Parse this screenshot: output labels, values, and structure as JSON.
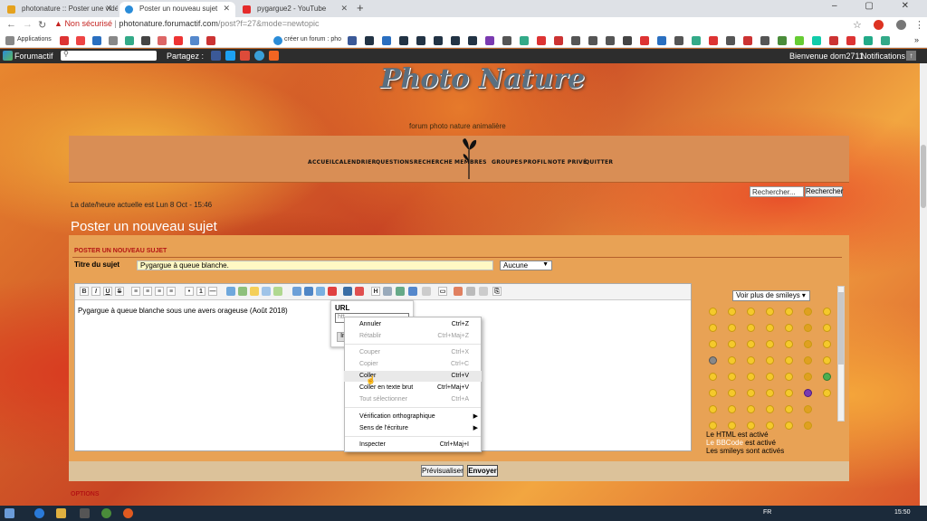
{
  "browser": {
    "tabs": [
      {
        "title": "photonature :: Poster une vidéo",
        "active": false,
        "favicon_color": "#e5a21e"
      },
      {
        "title": "Poster un nouveau sujet",
        "active": true,
        "favicon_color": "#2a8cd8"
      },
      {
        "title": "pygargue2 - YouTube",
        "active": false,
        "favicon_color": "#e52b2b"
      }
    ],
    "new_tab_label": "+",
    "window_controls": "– ▢ ✕",
    "security_label": "Non sécurisé",
    "url_host": "photonature.forumactif.com",
    "url_path": "/post?f=27&mode=newtopic",
    "star_icon": "☆",
    "menu_icon": "⋮",
    "bookmarks": {
      "apps_label": "Applications",
      "forum_label": "créer un forum : pho",
      "more_label": "»"
    }
  },
  "forumactif_bar": {
    "brand": "Forumactif",
    "share_label": "Partagez :",
    "welcome": "Bienvenue dom2711",
    "notifications": "Notifications"
  },
  "header": {
    "logo_text": "Photo Nature",
    "tagline": "forum photo nature animalière",
    "nav": [
      "ACCUEIL",
      "CALENDRIER",
      "QUESTIONS",
      "RECHERCHE",
      "MEMBRES",
      "GROUPES",
      "PROFIL",
      "NOTE PRIVÉ",
      "QUITTER"
    ],
    "search_placeholder": "Rechercher...",
    "search_button": "Rechercher"
  },
  "page": {
    "datetime": "La date/heure actuelle est Lun 8 Oct - 15:46",
    "title": "Poster un nouveau sujet",
    "panel_heading": "POSTER UN NOUVEAU SUJET",
    "subject_label": "Titre du sujet",
    "subject_value": "Pygargue à queue blanche.",
    "icon_select": "Aucune",
    "editor_text": "Pygargue à queue blanche sous une avers orageuse (Août 2018)",
    "options_label": "OPTIONS"
  },
  "toolbar_buttons": [
    "B",
    "I",
    "U",
    "S"
  ],
  "url_popup": {
    "label": "URL",
    "input_value": "htt",
    "button": "In"
  },
  "context_menu": {
    "items": [
      {
        "label": "Annuler",
        "shortcut": "Ctrl+Z",
        "disabled": false
      },
      {
        "label": "Rétablir",
        "shortcut": "Ctrl+Maj+Z",
        "disabled": true
      },
      {
        "label": "Couper",
        "shortcut": "Ctrl+X",
        "disabled": true
      },
      {
        "label": "Copier",
        "shortcut": "Ctrl+C",
        "disabled": true
      },
      {
        "label": "Coller",
        "shortcut": "Ctrl+V",
        "disabled": false,
        "hover": true
      },
      {
        "label": "Coller en texte brut",
        "shortcut": "Ctrl+Maj+V",
        "disabled": false
      },
      {
        "label": "Tout sélectionner",
        "shortcut": "Ctrl+A",
        "disabled": true
      },
      {
        "label": "Vérification orthographique",
        "shortcut": "",
        "disabled": false,
        "submenu": true
      },
      {
        "label": "Sens de l'écriture",
        "shortcut": "",
        "disabled": false,
        "submenu": true
      },
      {
        "label": "Inspecter",
        "shortcut": "Ctrl+Maj+I",
        "disabled": false
      }
    ]
  },
  "smileys": {
    "more_button": "Voir plus de smileys ▾",
    "html_status": "Le HTML est activé",
    "bbcode_status_link": "Le BBCode",
    "bbcode_status_suffix": "est activé",
    "smileys_status": "Les smileys sont activés"
  },
  "actions": {
    "preview": "Prévisualiser",
    "send": "Envoyer"
  },
  "taskbar": {
    "lang": "FR",
    "time": "15:50"
  }
}
